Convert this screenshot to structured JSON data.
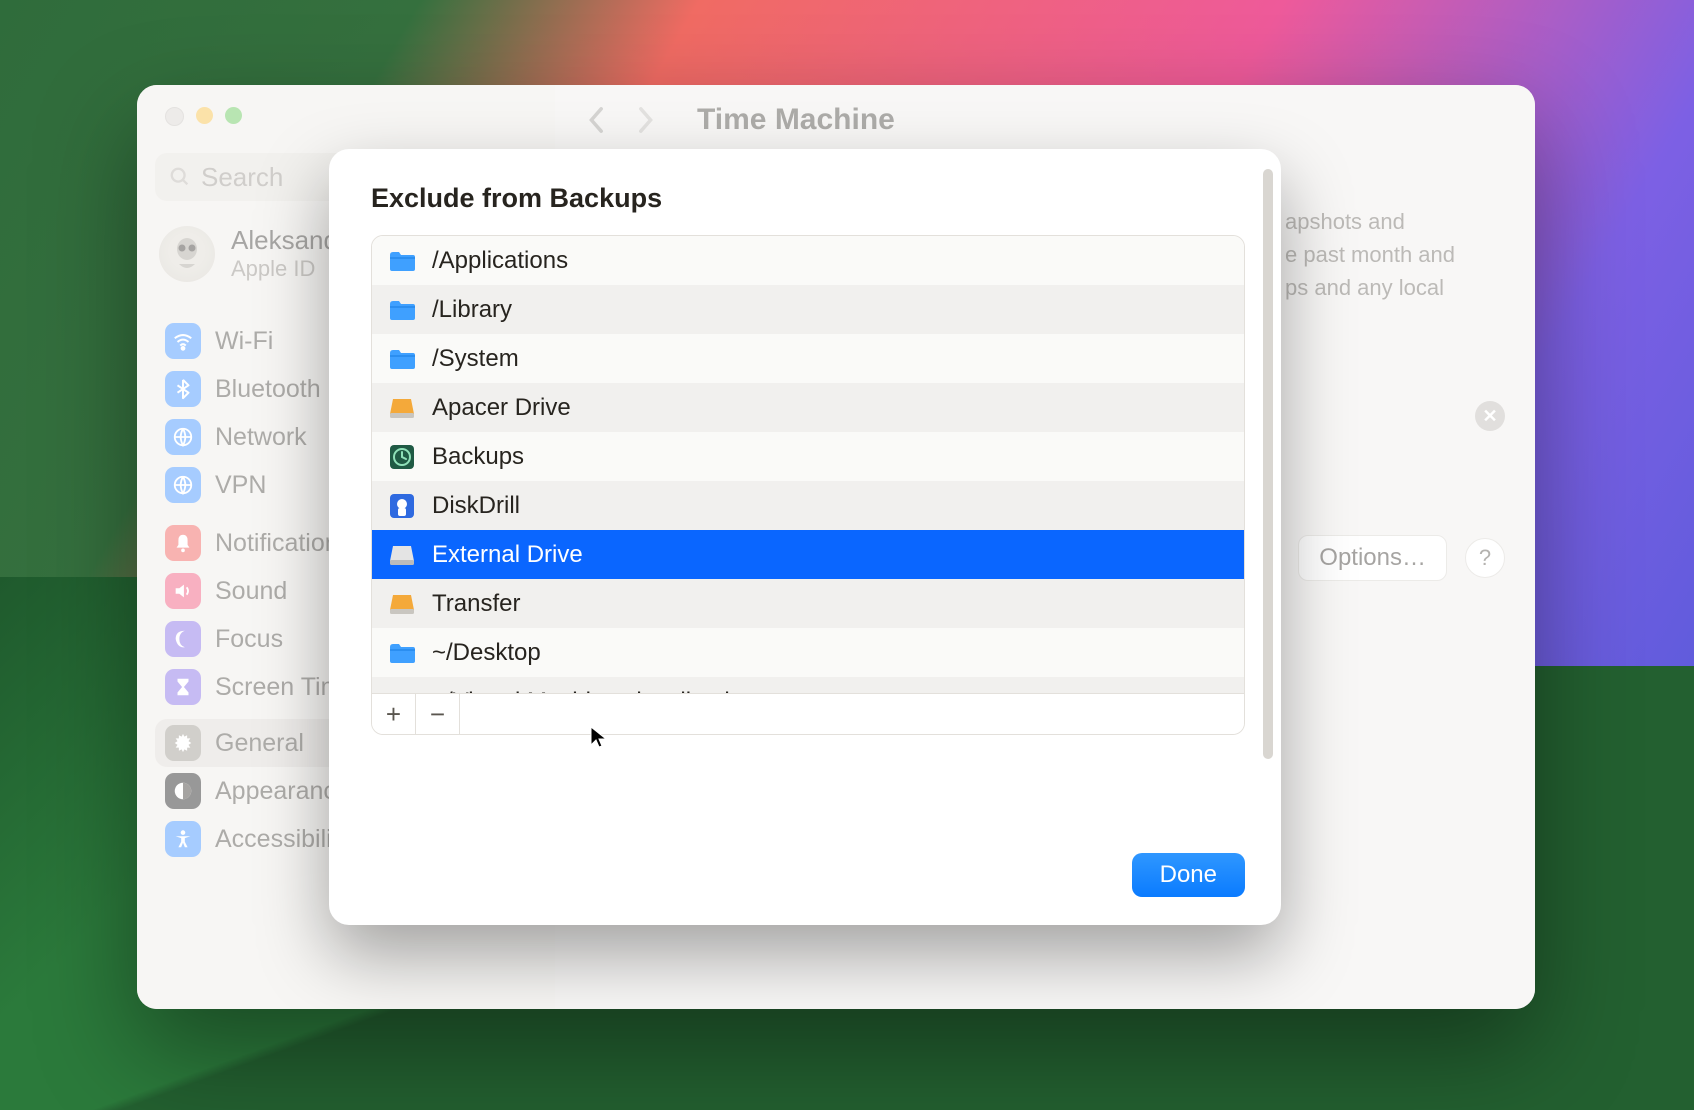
{
  "window": {
    "title": "Time Machine",
    "search_placeholder": "Search"
  },
  "user": {
    "name": "Aleksandr",
    "sub": "Apple ID"
  },
  "sidebar": {
    "g1": [
      {
        "icon": "wifi",
        "color": "#3a8eff",
        "label": "Wi-Fi"
      },
      {
        "icon": "bluetooth",
        "color": "#3a8eff",
        "label": "Bluetooth"
      },
      {
        "icon": "globe",
        "color": "#3a8eff",
        "label": "Network"
      },
      {
        "icon": "globe",
        "color": "#3a8eff",
        "label": "VPN"
      }
    ],
    "g2": [
      {
        "icon": "bell",
        "color": "#ef5753",
        "label": "Notifications"
      },
      {
        "icon": "sound",
        "color": "#ef5077",
        "label": "Sound"
      },
      {
        "icon": "moon",
        "color": "#8268e4",
        "label": "Focus"
      },
      {
        "icon": "hourglass",
        "color": "#8268e4",
        "label": "Screen Time"
      }
    ],
    "g3": [
      {
        "icon": "gear",
        "color": "#9a958c",
        "label": "General",
        "active": true
      },
      {
        "icon": "appearance",
        "color": "#1c1c1c",
        "label": "Appearance"
      },
      {
        "icon": "accessibility",
        "color": "#3a8eff",
        "label": "Accessibility"
      }
    ]
  },
  "main": {
    "desc_lines": [
      "apshots and",
      "e past month and",
      "ps and any local"
    ],
    "options_label": "Options…",
    "help_label": "?"
  },
  "sheet": {
    "title": "Exclude from Backups",
    "items": [
      {
        "icon": "folder-app",
        "label": "/Applications"
      },
      {
        "icon": "folder-lib",
        "label": "/Library"
      },
      {
        "icon": "folder-sys",
        "label": "/System"
      },
      {
        "icon": "drive-ext",
        "label": "Apacer Drive"
      },
      {
        "icon": "tm-disk",
        "label": "Backups"
      },
      {
        "icon": "app-icon",
        "label": "DiskDrill"
      },
      {
        "icon": "drive",
        "label": "External Drive",
        "selected": true
      },
      {
        "icon": "drive-ext",
        "label": "Transfer"
      },
      {
        "icon": "folder-desktop",
        "label": "~/Desktop"
      },
      {
        "icon": "folder",
        "label": "~/Virtual Machines.localized"
      }
    ],
    "add_label": "+",
    "remove_label": "−",
    "done_label": "Done"
  }
}
